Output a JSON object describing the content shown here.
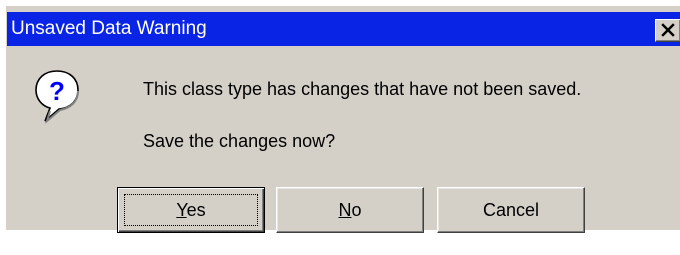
{
  "window": {
    "title": "Unsaved Data Warning",
    "close_glyph": "✕"
  },
  "icon": {
    "name": "question-icon",
    "glyph": "?",
    "color": "#0000ff"
  },
  "message": {
    "line1": "This class type has changes that have not been saved.",
    "line2": "Save the changes now?"
  },
  "buttons": {
    "yes": {
      "mnemonic": "Y",
      "rest": "es",
      "label": "Yes",
      "default": true
    },
    "no": {
      "mnemonic": "N",
      "rest": "o",
      "label": "No"
    },
    "cancel": {
      "label": "Cancel"
    }
  },
  "colors": {
    "titlebar": "#0a24e6",
    "dialog_face": "#d4d0c8"
  }
}
